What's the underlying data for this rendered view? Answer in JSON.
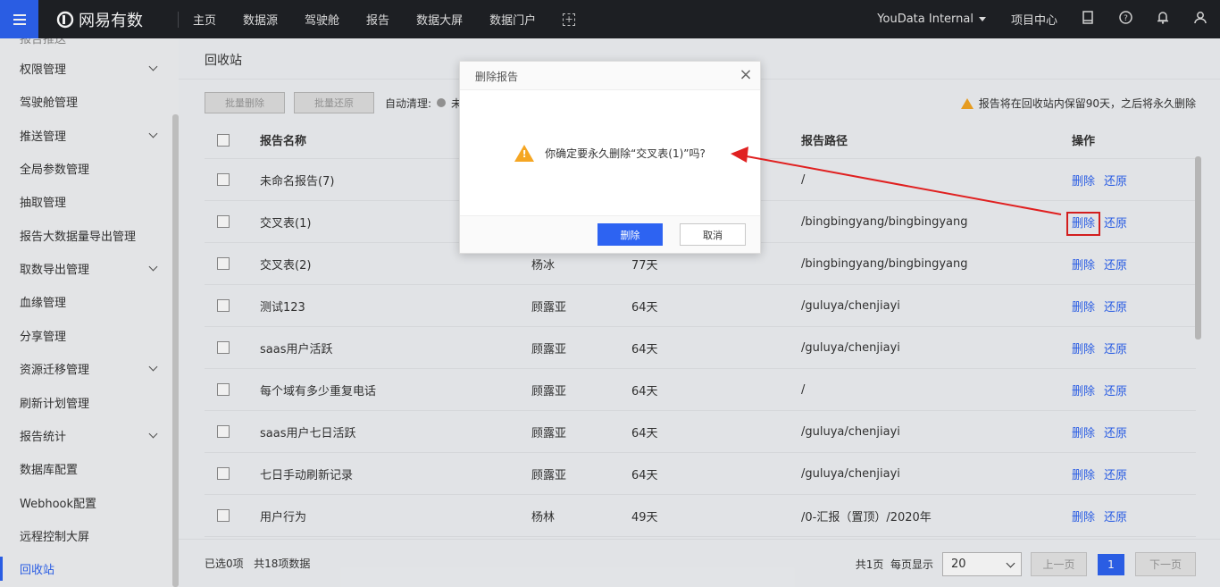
{
  "topbar": {
    "logo_text": "网易有数",
    "nav": [
      "主页",
      "数据源",
      "驾驶舱",
      "报告",
      "数据大屏",
      "数据门户"
    ],
    "org": "YouData Internal",
    "project_center": "项目中心"
  },
  "sidebar": {
    "cut_item": "报告推送",
    "items": [
      {
        "label": "权限管理",
        "expandable": true
      },
      {
        "label": "驾驶舱管理",
        "expandable": false
      },
      {
        "label": "推送管理",
        "expandable": true
      },
      {
        "label": "全局参数管理",
        "expandable": false
      },
      {
        "label": "抽取管理",
        "expandable": false
      },
      {
        "label": "报告大数据量导出管理",
        "expandable": false
      },
      {
        "label": "取数导出管理",
        "expandable": true
      },
      {
        "label": "血缘管理",
        "expandable": false
      },
      {
        "label": "分享管理",
        "expandable": false
      },
      {
        "label": "资源迁移管理",
        "expandable": true
      },
      {
        "label": "刷新计划管理",
        "expandable": false
      },
      {
        "label": "报告统计",
        "expandable": true
      },
      {
        "label": "数据库配置",
        "expandable": false
      },
      {
        "label": "Webhook配置",
        "expandable": false
      },
      {
        "label": "远程控制大屏",
        "expandable": false
      },
      {
        "label": "回收站",
        "expandable": false,
        "active": true
      }
    ]
  },
  "main": {
    "title": "回收站",
    "batch_delete": "批量删除",
    "batch_restore": "批量还原",
    "auto_clean_label": "自动清理:",
    "auto_clean_value": "未",
    "retain_notice": "报告将在回收站内保留90天，之后将永久删除",
    "columns": {
      "name": "报告名称",
      "path": "报告路径",
      "ops": "操作"
    },
    "delete_label": "删除",
    "restore_label": "还原",
    "rows": [
      {
        "name": "未命名报告(7)",
        "owner": "",
        "days": "",
        "path": "/"
      },
      {
        "name": "交叉表(1)",
        "owner": "",
        "days": "",
        "path": "/bingbingyang/bingbingyang"
      },
      {
        "name": "交叉表(2)",
        "owner": "杨冰",
        "days": "77天",
        "path": "/bingbingyang/bingbingyang"
      },
      {
        "name": "测试123",
        "owner": "顾露亚",
        "days": "64天",
        "path": "/guluya/chenjiayi"
      },
      {
        "name": "saas用户活跃",
        "owner": "顾露亚",
        "days": "64天",
        "path": "/guluya/chenjiayi"
      },
      {
        "name": "每个域有多少重复电话",
        "owner": "顾露亚",
        "days": "64天",
        "path": "/"
      },
      {
        "name": "saas用户七日活跃",
        "owner": "顾露亚",
        "days": "64天",
        "path": "/guluya/chenjiayi"
      },
      {
        "name": "七日手动刷新记录",
        "owner": "顾露亚",
        "days": "64天",
        "path": "/guluya/chenjiayi"
      },
      {
        "name": "用户行为",
        "owner": "杨林",
        "days": "49天",
        "path": "/0-汇报（置顶）/2020年"
      }
    ],
    "footer": {
      "selected": "已选0项",
      "total": "共18项数据",
      "pages": "共1页",
      "per_page_label": "每页显示",
      "per_page_value": "20",
      "prev": "上一页",
      "current": "1",
      "next": "下一页"
    }
  },
  "dialog": {
    "title": "删除报告",
    "message": "你确定要永久删除“交叉表(1)”吗?",
    "confirm": "删除",
    "cancel": "取消"
  },
  "colors": {
    "accent": "#2d63f2",
    "topbar": "#1f2126",
    "annotation": "#e02020",
    "warning": "#f5a623"
  }
}
